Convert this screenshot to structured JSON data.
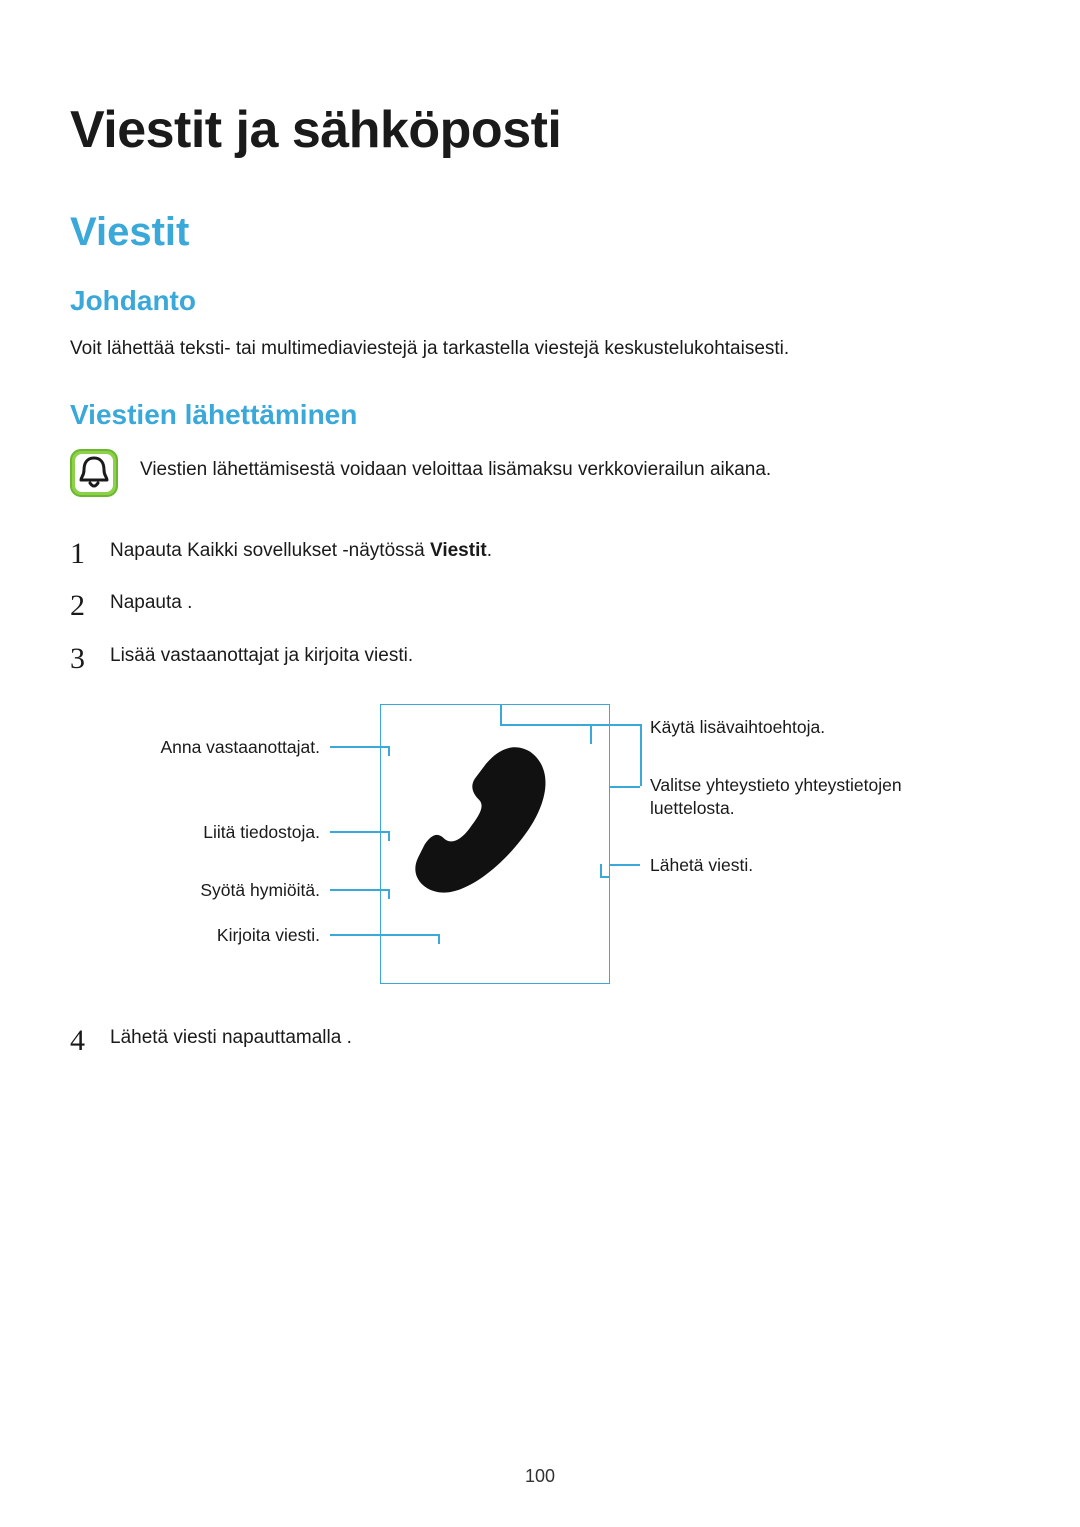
{
  "page_number": "100",
  "h1": "Viestit ja sähköposti",
  "h2": "Viestit",
  "intro": {
    "heading": "Johdanto",
    "text": "Voit lähettää teksti- tai multimediaviestejä ja tarkastella viestejä keskustelukohtaisesti."
  },
  "sending": {
    "heading": "Viestien lähettäminen",
    "note": "Viestien lähettämisestä voidaan veloittaa lisämaksu verkkovierailun aikana.",
    "steps": {
      "s1_pre": "Napauta Kaikki sovellukset -näytössä ",
      "s1_bold": "Viestit",
      "s1_post": ".",
      "s2": "Napauta    .",
      "s3": "Lisää vastaanottajat ja kirjoita viesti.",
      "s4": "Lähetä viesti napauttamalla       ."
    }
  },
  "diagram_labels": {
    "left": {
      "recipients": "Anna vastaanottajat.",
      "attach": "Liitä tiedostoja.",
      "emoji": "Syötä hymiöitä.",
      "write": "Kirjoita viesti."
    },
    "right": {
      "more": "Käytä lisävaihtoehtoja.",
      "contacts": "Valitse yhteystieto yhteystietojen luettelosta.",
      "send": "Lähetä viesti."
    }
  }
}
